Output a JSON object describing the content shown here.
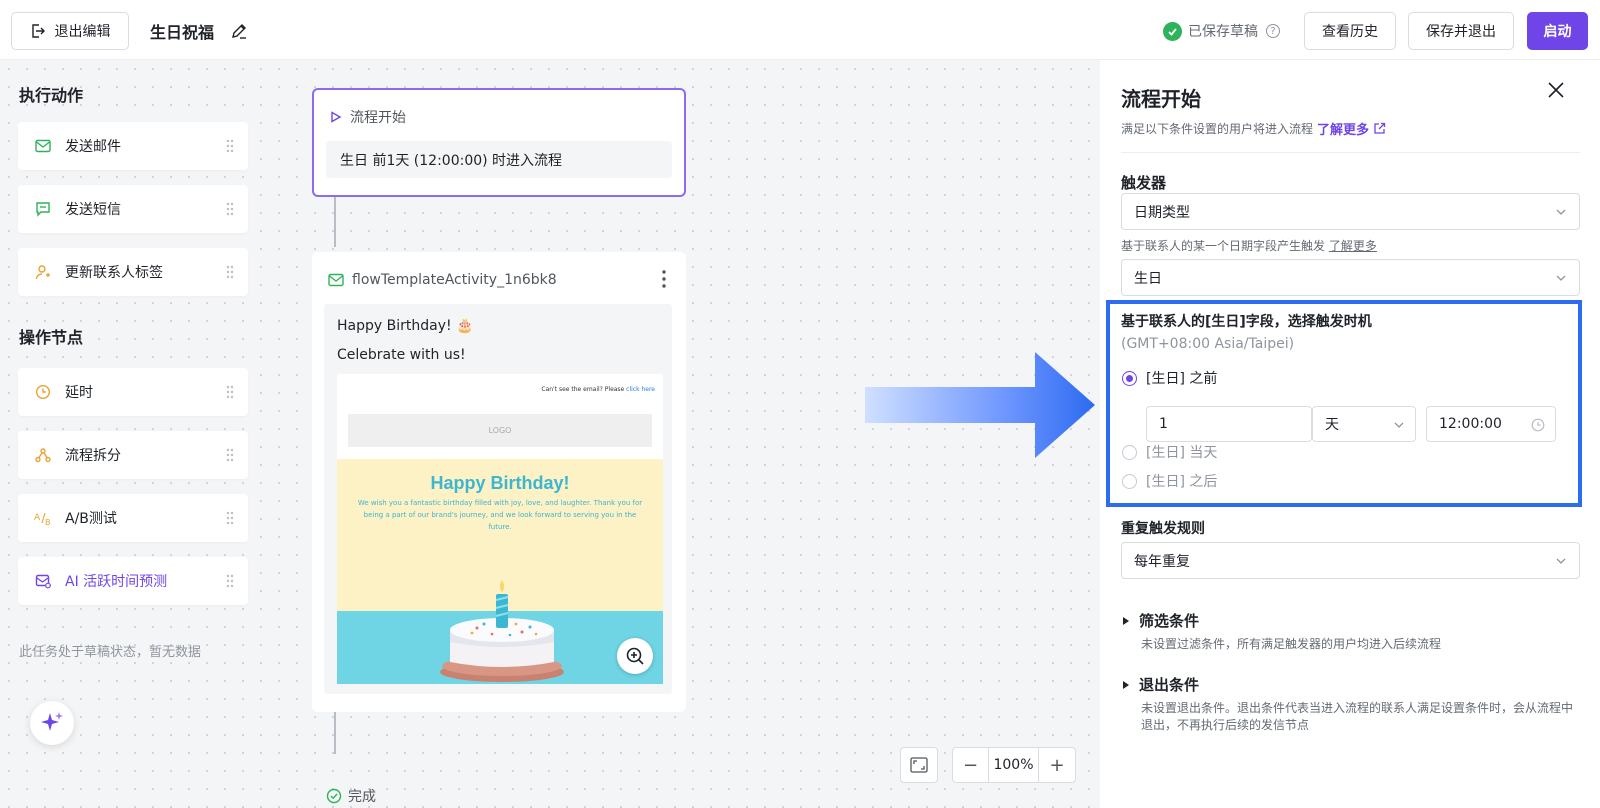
{
  "topbar": {
    "exit_label": "退出编辑",
    "title": "生日祝福",
    "saved_label": "已保存草稿",
    "history_label": "查看历史",
    "save_exit_label": "保存并退出",
    "start_label": "启动"
  },
  "sidebar": {
    "actions_title": "执行动作",
    "actions": [
      {
        "label": "发送邮件",
        "icon": "mail-icon"
      },
      {
        "label": "发送短信",
        "icon": "message-icon"
      },
      {
        "label": "更新联系人标签",
        "icon": "user-tag-icon"
      }
    ],
    "nodes_title": "操作节点",
    "nodes": [
      {
        "label": "延时",
        "icon": "clock-icon"
      },
      {
        "label": "流程拆分",
        "icon": "split-icon"
      },
      {
        "label": "A/B测试",
        "icon": "ab-test-icon"
      },
      {
        "label": "AI 活跃时间预测",
        "icon": "ai-predict-icon"
      }
    ],
    "draft_note": "此任务处于草稿状态，暂无数据"
  },
  "flow": {
    "start_title": "流程开始",
    "start_condition": "生日 前1天 (12:00:00) 时进入流程",
    "email_title": "flowTemplateActivity_1n6bk8",
    "email_line1": "Happy Birthday! 🎂",
    "email_line2": "Celebrate with us!",
    "preview_top_text": "Can't see the email? Please ",
    "preview_top_link": "click here",
    "preview_logo": "LOGO",
    "preview_heading": "Happy Birthday!",
    "preview_text": "We wish you a fantastic birthday filled with joy, love, and laughter. Thank you for being a part of our brand's journey, and we look forward to serving you in the future.",
    "done_label": "完成"
  },
  "zoom": {
    "minus": "−",
    "value": "100%",
    "plus": "+"
  },
  "panel": {
    "title": "流程开始",
    "subtitle": "满足以下条件设置的用户将进入流程",
    "learn_more": "了解更多",
    "trigger_title": "触发器",
    "trigger_type": "日期类型",
    "trigger_hint": "基于联系人的某一个日期字段产生触发",
    "trigger_hint_link": "了解更多",
    "date_field": "生日",
    "timing_title": "基于联系人的[生日]字段，选择触发时机",
    "timezone": "(GMT+08:00 Asia/Taipei)",
    "option_before": "[生日] 之前",
    "offset_value": "1",
    "offset_unit": "天",
    "time_value": "12:00:00",
    "option_same_day": "[生日] 当天",
    "option_after": "[生日] 之后",
    "repeat_title": "重复触发规则",
    "repeat_value": "每年重复",
    "filter_title": "筛选条件",
    "filter_desc": "未设置过滤条件，所有满足触发器的用户均进入后续流程",
    "exit_title": "退出条件",
    "exit_desc": "未设置退出条件。退出条件代表当进入流程的联系人满足设置条件时，会从流程中退出，不再执行后续的发信节点"
  },
  "colors": {
    "accent": "#6f45e8",
    "highlight": "#2d6bf0",
    "success": "#2fb25c"
  }
}
